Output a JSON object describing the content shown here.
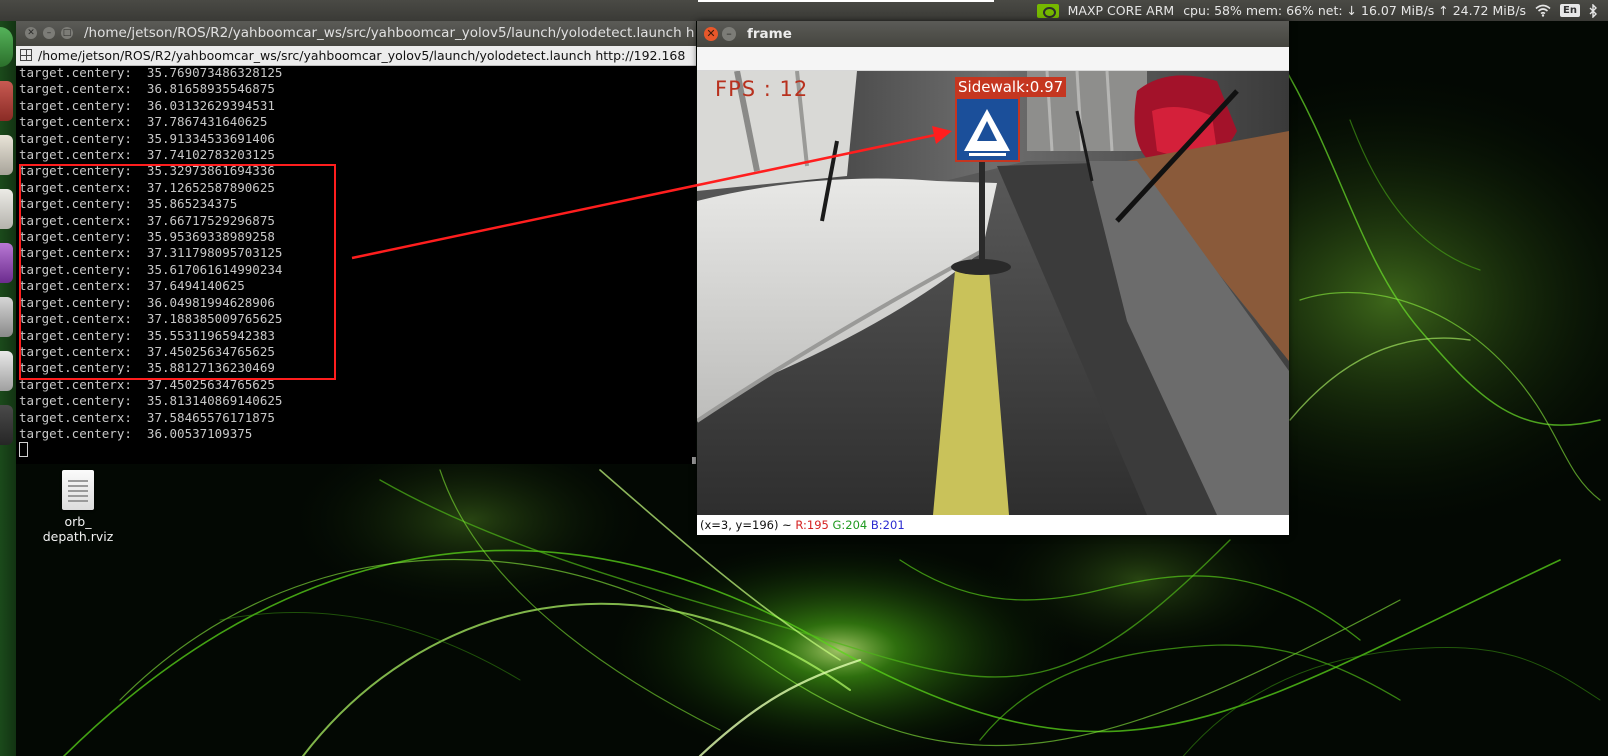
{
  "panel": {
    "power_mode": "MAXP CORE ARM",
    "stats": "cpu: 58% mem: 66% net: ↓ 16.07 MiB/s ↑ 24.72 MiB/s",
    "language": "En",
    "icons": [
      "nvidia-icon",
      "wifi-icon",
      "keyboard-language-icon",
      "bluetooth-icon"
    ]
  },
  "terminal": {
    "window_title": "/home/jetson/ROS/R2/yahboomcar_ws/src/yahboomcar_yolov5/launch/yolodetect.launch h",
    "tab_title": "/home/jetson/ROS/R2/yahboomcar_ws/src/yahboomcar_yolov5/launch/yolodetect.launch http://192.168",
    "lines": [
      "target.centery:  35.769073486328125",
      "target.centerx:  36.81658935546875",
      "target.centery:  36.03132629394531",
      "target.centerx:  37.7867431640625",
      "target.centery:  35.91334533691406",
      "target.centerx:  37.74102783203125",
      "target.centery:  35.32973861694336",
      "target.centerx:  37.12652587890625",
      "target.centery:  35.865234375",
      "target.centerx:  37.66717529296875",
      "target.centery:  35.95369338989258",
      "target.centerx:  37.311798095703125",
      "target.centery:  35.617061614990234",
      "target.centerx:  37.6494140625",
      "target.centery:  36.04981994628906",
      "target.centerx:  37.188385009765625",
      "target.centery:  35.55311965942383",
      "target.centerx:  37.45025634765625",
      "target.centery:  35.88127136230469",
      "target.centerx:  37.45025634765625",
      "target.centery:  35.813140869140625",
      "target.centerx:  37.58465576171875",
      "target.centery:  36.00537109375"
    ]
  },
  "frame_window": {
    "title": "frame",
    "fps_text": "FPS : 12",
    "detection_label": "Sidewalk:0.97",
    "status": {
      "coords": "(x=3, y=196) ~ ",
      "r": "R:195",
      "g": "G:204",
      "b": "B:201"
    }
  },
  "desktop": {
    "file_label_line1": "orb_",
    "file_label_line2": "depath.rviz"
  },
  "colors": {
    "annotation_red": "#ff1e1e",
    "detection_box": "#c53620",
    "nvidia_green": "#76b900"
  }
}
